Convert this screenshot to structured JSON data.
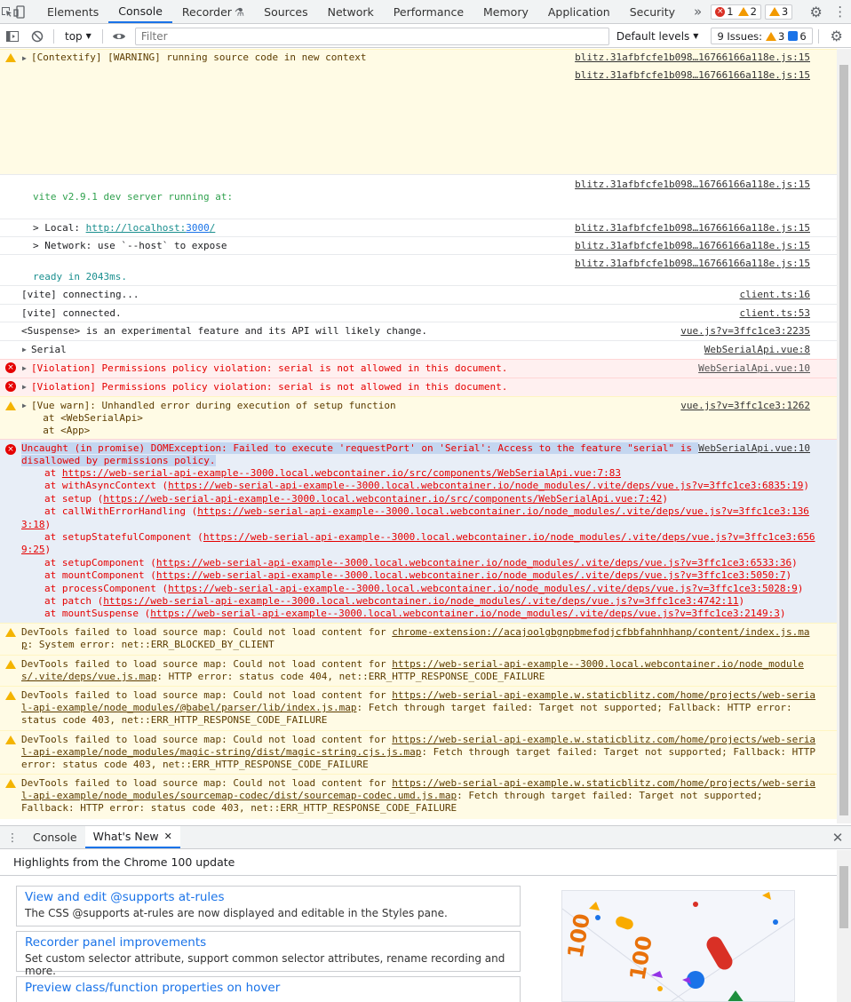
{
  "tabs": [
    "Elements",
    "Console",
    "Recorder",
    "Sources",
    "Network",
    "Performance",
    "Memory",
    "Application",
    "Security"
  ],
  "active_tab": "Console",
  "counts": {
    "errors": "1",
    "warnings": "2",
    "issues_badge": "3"
  },
  "toolbar": {
    "context": "top",
    "filter_placeholder": "Filter",
    "levels": "Default levels",
    "issues_label": "9 Issues:",
    "issues_warn": "3",
    "issues_info": "6"
  },
  "colors": {
    "accent": "#1a73e8",
    "error": "#e50000",
    "warning_bg": "#fffbe5",
    "error_bg": "#fff0f0",
    "selected_bg": "#e8eef7"
  },
  "console": {
    "contextify": "[Contextify] [WARNING] running source code in new context",
    "src_blitz": "blitz.31afbfcfe1b098…16766166a118e.js:15",
    "vite_running": "vite v2.9.1 dev server running at:",
    "local_prefix": "> Local: ",
    "local_url_a": "http://localhost:",
    "local_url_b": "3000",
    "local_url_c": "/",
    "network": "> Network: use `--host` to expose",
    "ready": "ready in 2043ms.",
    "connecting": "[vite] connecting...",
    "src_client16": "client.ts:16",
    "connected": "[vite] connected.",
    "src_client53": "client.ts:53",
    "suspense": "<Suspense> is an experimental feature and its API will likely change.",
    "src_vue2235": "vue.js?v=3ffc1ce3:2235",
    "serial": "Serial",
    "src_wsa8": "WebSerialApi.vue:8",
    "violation": "[Violation] Permissions policy violation: serial is not allowed in this document.",
    "src_wsa10": "WebSerialApi.vue:10",
    "vue_warn": "[Vue warn]: Unhandled error during execution of setup function",
    "vue_warn_at1": "  at <WebSerialApi>",
    "vue_warn_at2": "  at <App>",
    "src_vue1262": "vue.js?v=3ffc1ce3:1262",
    "uncaught_1": "Uncaught (in promise) DOMException: Failed to execute 'requestPort' on 'Serial': Access to the feature \"serial\" is ",
    "uncaught_2": "disallowed by permissions policy.",
    "stack": [
      {
        "prefix": "at ",
        "link": "https://web-serial-api-example--3000.local.webcontainer.io/src/components/WebSerialApi.vue:7:83",
        "suffix": ""
      },
      {
        "prefix": "at withAsyncContext (",
        "link": "https://web-serial-api-example--3000.local.webcontainer.io/node_modules/.vite/deps/vue.js?v=3ffc1ce3:6835:19",
        "suffix": ")"
      },
      {
        "prefix": "at setup (",
        "link": "https://web-serial-api-example--3000.local.webcontainer.io/src/components/WebSerialApi.vue:7:42",
        "suffix": ")"
      },
      {
        "prefix": "at callWithErrorHandling (",
        "link": "https://web-serial-api-example--3000.local.webcontainer.io/node_modules/.vite/deps/vue.js?v=3ffc1ce3:136",
        "suffix": ""
      },
      {
        "prefix": "",
        "link": "3:18",
        "suffix": ")",
        "wrap": true
      },
      {
        "prefix": "at setupStatefulComponent (",
        "link": "https://web-serial-api-example--3000.local.webcontainer.io/node_modules/.vite/deps/vue.js?v=3ffc1ce3:656",
        "suffix": ""
      },
      {
        "prefix": "",
        "link": "9:25",
        "suffix": ")",
        "wrap": true
      },
      {
        "prefix": "at setupComponent (",
        "link": "https://web-serial-api-example--3000.local.webcontainer.io/node_modules/.vite/deps/vue.js?v=3ffc1ce3:6533:36",
        "suffix": ")"
      },
      {
        "prefix": "at mountComponent (",
        "link": "https://web-serial-api-example--3000.local.webcontainer.io/node_modules/.vite/deps/vue.js?v=3ffc1ce3:5050:7",
        "suffix": ")"
      },
      {
        "prefix": "at processComponent (",
        "link": "https://web-serial-api-example--3000.local.webcontainer.io/node_modules/.vite/deps/vue.js?v=3ffc1ce3:5028:9",
        "suffix": ")"
      },
      {
        "prefix": "at patch (",
        "link": "https://web-serial-api-example--3000.local.webcontainer.io/node_modules/.vite/deps/vue.js?v=3ffc1ce3:4742:11",
        "suffix": ")"
      },
      {
        "prefix": "at mountSuspense (",
        "link": "https://web-serial-api-example--3000.local.webcontainer.io/node_modules/.vite/deps/vue.js?v=3ffc1ce3:2149:3",
        "suffix": ")"
      }
    ],
    "sourcemap_warnings": [
      {
        "l1a": "DevTools failed to load source map: Could not load content for ",
        "l1b": "chrome-extension://acajoolgbgnpbmefodjcfbbfahnhhanp/content/index.js.ma",
        "l2a": "p",
        "l2b": ": System error: net::ERR_BLOCKED_BY_CLIENT",
        "l3": ""
      },
      {
        "l1a": "DevTools failed to load source map: Could not load content for ",
        "l1b": "https://web-serial-api-example--3000.local.webcontainer.io/node_module",
        "l2a": "s/.vite/deps/vue.js.map",
        "l2b": ": HTTP error: status code 404, net::ERR_HTTP_RESPONSE_CODE_FAILURE",
        "l3": ""
      },
      {
        "l1a": "DevTools failed to load source map: Could not load content for ",
        "l1b": "https://web-serial-api-example.w.staticblitz.com/home/projects/web-seria",
        "l2a": "l-api-example/node_modules/@babel/parser/lib/index.js.map",
        "l2b": ": Fetch through target failed: Target not supported; Fallback: HTTP error:",
        "l3": "status code 403, net::ERR_HTTP_RESPONSE_CODE_FAILURE"
      },
      {
        "l1a": "DevTools failed to load source map: Could not load content for ",
        "l1b": "https://web-serial-api-example.w.staticblitz.com/home/projects/web-seria",
        "l2a": "l-api-example/node_modules/magic-string/dist/magic-string.cjs.js.map",
        "l2b": ": Fetch through target failed: Target not supported; Fallback: HTTP",
        "l3": "error: status code 403, net::ERR_HTTP_RESPONSE_CODE_FAILURE"
      },
      {
        "l1a": "DevTools failed to load source map: Could not load content for ",
        "l1b": "https://web-serial-api-example.w.staticblitz.com/home/projects/web-seria",
        "l2a": "l-api-example/node_modules/sourcemap-codec/dist/sourcemap-codec.umd.js.map",
        "l2b": ": Fetch through target failed: Target not supported;",
        "l3": "Fallback: HTTP error: status code 403, net::ERR_HTTP_RESPONSE_CODE_FAILURE"
      }
    ]
  },
  "drawer": {
    "tabs": [
      "Console",
      "What's New"
    ],
    "active": "What's New",
    "highlights": "Highlights from the Chrome 100 update",
    "cards": [
      {
        "title": "View and edit @supports at-rules",
        "desc": "The CSS @supports at-rules are now displayed and editable in the Styles pane."
      },
      {
        "title": "Recorder panel improvements",
        "desc": "Set custom selector attribute, support common selector attributes, rename recording and more."
      },
      {
        "title": "Preview class/function properties on hover",
        "desc": ""
      }
    ]
  }
}
